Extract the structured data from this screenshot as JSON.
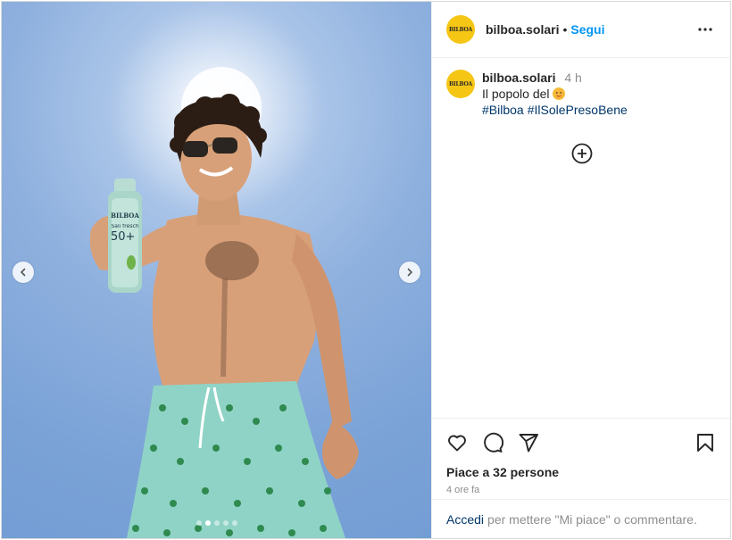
{
  "account": {
    "username": "bilboa.solari",
    "avatar_text": "BILBOA",
    "follow_label": "Segui",
    "separator": "•"
  },
  "caption": {
    "username": "bilboa.solari",
    "time": "4 h",
    "text": "Il popolo del",
    "emoji": "hot-face-emoji",
    "hashtags": [
      "#Bilboa",
      "#IlSolePresoBene"
    ]
  },
  "product": {
    "brand": "BILBOA",
    "line": "Sali fresch",
    "spf": "50+"
  },
  "carousel": {
    "slides": 5,
    "active_index": 1
  },
  "engagement": {
    "likes_text": "Piace a 32 persone",
    "time_ago": "4 ore fa"
  },
  "login_prompt": {
    "link": "Accedi",
    "text": "per mettere \"Mi piace\" o commentare."
  },
  "icons": [
    "more-icon",
    "heart-icon",
    "comment-icon",
    "share-icon",
    "bookmark-icon",
    "add-comment-icon",
    "chevron-left-icon",
    "chevron-right-icon"
  ],
  "colors": {
    "link": "#0095f6",
    "hashtag": "#00376b",
    "avatar": "#f6c615",
    "muted": "#8e8e8e"
  }
}
